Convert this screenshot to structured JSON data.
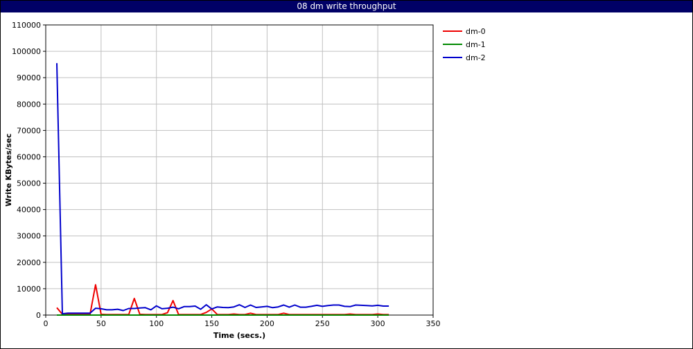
{
  "window": {
    "title": "08 dm write throughput"
  },
  "chart_data": {
    "type": "line",
    "title": "08 dm write throughput",
    "xlabel": "Time (secs.)",
    "ylabel": "Write KBytes/sec",
    "xlim": [
      0,
      350
    ],
    "ylim": [
      0,
      110000
    ],
    "xticks": [
      0,
      50,
      100,
      150,
      200,
      250,
      300,
      350
    ],
    "yticks": [
      0,
      10000,
      20000,
      30000,
      40000,
      50000,
      60000,
      70000,
      80000,
      90000,
      100000,
      110000
    ],
    "grid": true,
    "legend_position": "right",
    "series": [
      {
        "name": "dm-0",
        "color": "#ee0000",
        "x": [
          10,
          15,
          20,
          25,
          30,
          35,
          40,
          45,
          50,
          55,
          60,
          65,
          70,
          75,
          80,
          85,
          90,
          95,
          100,
          105,
          110,
          115,
          120,
          125,
          130,
          135,
          140,
          145,
          150,
          155,
          160,
          165,
          170,
          175,
          180,
          185,
          190,
          195,
          200,
          205,
          210,
          215,
          220,
          225,
          230,
          235,
          240,
          245,
          250,
          255,
          260,
          265,
          270,
          275,
          280,
          285,
          290,
          295,
          300,
          305,
          310
        ],
        "values": [
          2800,
          300,
          300,
          300,
          300,
          300,
          300,
          11500,
          300,
          200,
          200,
          200,
          200,
          200,
          6300,
          300,
          200,
          200,
          200,
          200,
          900,
          5500,
          200,
          200,
          200,
          200,
          200,
          1000,
          2300,
          200,
          200,
          200,
          400,
          200,
          200,
          700,
          200,
          200,
          200,
          200,
          200,
          700,
          200,
          200,
          200,
          200,
          200,
          200,
          200,
          200,
          200,
          200,
          200,
          400,
          200,
          200,
          200,
          200,
          400,
          200,
          200
        ]
      },
      {
        "name": "dm-1",
        "color": "#008800",
        "x": [
          10,
          310
        ],
        "values": [
          0,
          0
        ]
      },
      {
        "name": "dm-2",
        "color": "#0000cc",
        "x": [
          10,
          15,
          20,
          25,
          30,
          35,
          40,
          45,
          50,
          55,
          60,
          65,
          70,
          75,
          80,
          85,
          90,
          95,
          100,
          105,
          110,
          115,
          120,
          125,
          130,
          135,
          140,
          145,
          150,
          155,
          160,
          165,
          170,
          175,
          180,
          185,
          190,
          195,
          200,
          205,
          210,
          215,
          220,
          225,
          230,
          235,
          240,
          245,
          250,
          255,
          260,
          265,
          270,
          275,
          280,
          285,
          290,
          295,
          300,
          305,
          310
        ],
        "values": [
          95500,
          500,
          700,
          700,
          700,
          700,
          700,
          2600,
          2400,
          2000,
          2000,
          2200,
          1700,
          2500,
          2500,
          2700,
          2800,
          2000,
          3500,
          2400,
          2600,
          3000,
          2400,
          3200,
          3200,
          3400,
          2200,
          3900,
          2300,
          3100,
          2900,
          2800,
          3100,
          3900,
          2900,
          3800,
          2900,
          3100,
          3300,
          2800,
          3100,
          3800,
          3000,
          3800,
          3000,
          3000,
          3300,
          3700,
          3300,
          3600,
          3800,
          3800,
          3300,
          3200,
          3800,
          3700,
          3600,
          3500,
          3700,
          3400,
          3400
        ]
      }
    ]
  }
}
